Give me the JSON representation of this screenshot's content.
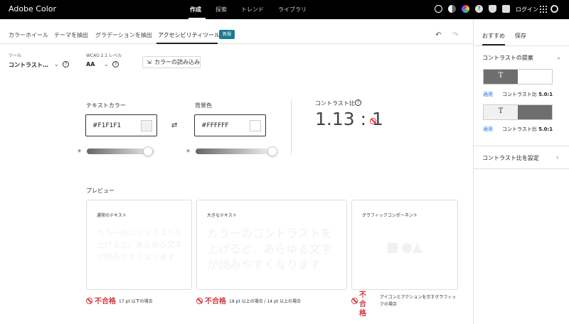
{
  "app": {
    "title": "Adobe Color"
  },
  "topnav": {
    "items": [
      "作成",
      "探索",
      "トレンド",
      "ライブラリ"
    ],
    "active": "作成",
    "login": "ログイン"
  },
  "icons": [
    "add-icon",
    "theme-icon",
    "color-wheel-icon",
    "help-icon",
    "notification-icon",
    "chat-icon",
    "apps-grid-icon",
    "creative-cloud-icon"
  ],
  "tabs": {
    "items": [
      "カラーホイール",
      "テーマを抽出",
      "グラデーションを抽出",
      "アクセシビリティツール"
    ],
    "active": "アクセシビリティツール",
    "badge": "新規"
  },
  "tools": {
    "tool_label": "ツール",
    "tool_value": "コントラスト…",
    "wcag_label": "WCAG 2.1 レベル",
    "wcag_value": "AA",
    "import_label": "カラーの読み込み"
  },
  "text_color": {
    "label": "テキストカラー",
    "value": "#F1F1F1",
    "swatch": "#F1F1F1",
    "slider_level": 0.9
  },
  "bg_color": {
    "label": "背景色",
    "value": "#FFFFFF",
    "swatch": "#FFFFFF",
    "slider_level": 1.0
  },
  "contrast": {
    "label": "コントラスト比",
    "value": "1.13 : 1"
  },
  "preview": {
    "title": "プレビュー",
    "cards": [
      {
        "title": "通常のテキスト",
        "sample": "カラーのコントラストを上げると、あらゆる文字が読みやすくなります"
      },
      {
        "title": "大きなテキスト",
        "sample": "カラーのコントラストを上げると、あらゆる文字が読みやすくなります"
      },
      {
        "title": "グラフィックコンポーネント",
        "sample": ""
      }
    ],
    "results": [
      {
        "status": "不合格",
        "desc": "17 pt 以下の場合"
      },
      {
        "status": "不合格",
        "desc": "18 pt 以上の場合 / 14 pt 以上の場合"
      },
      {
        "status": "不合格",
        "desc_line1": "アイコンとアクションを示すグラフィッ",
        "desc_line2": "クの場合"
      }
    ]
  },
  "right_panel": {
    "tabs": [
      "おすすめ",
      "保存"
    ],
    "suggestions_title": "コントラストの提案",
    "suggestions": [
      {
        "apply": "適用",
        "ratio_label": "コントラスト比",
        "ratio_value": "5.0:1",
        "text_color": "#FFFFFF",
        "bg_colors": [
          "#6E6E6E",
          "#FFFFFF"
        ]
      },
      {
        "apply": "適用",
        "ratio_label": "コントラスト比",
        "ratio_value": "5.0:1",
        "text_color": "#3A3A3A",
        "bg_colors": [
          "#F1F1F1",
          "#6E6E6E"
        ]
      }
    ],
    "set_ratio_label": "コントラスト比を設定"
  },
  "colors": {
    "accent": "#1473E6",
    "fail": "#D7373F",
    "badge": "#1F7B8F"
  }
}
